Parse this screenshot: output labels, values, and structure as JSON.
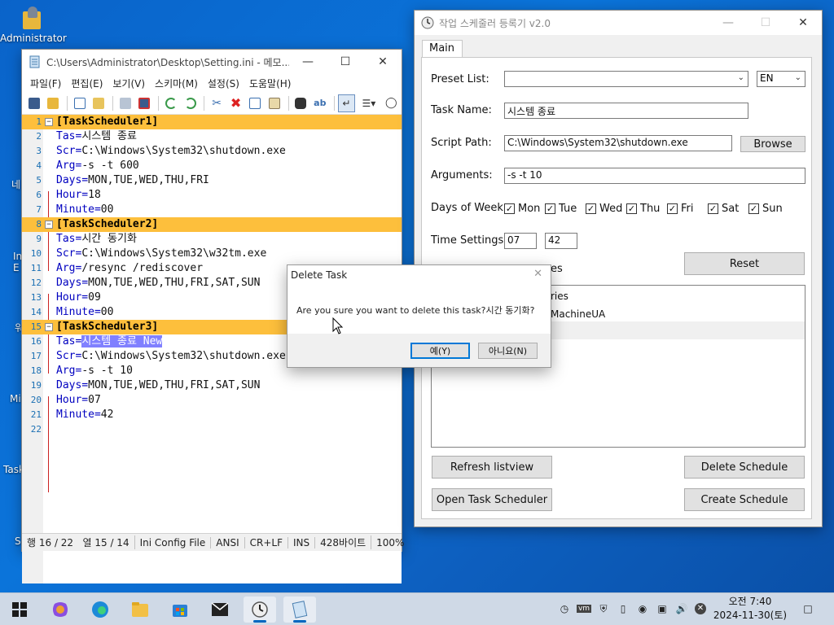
{
  "desktop": {
    "icon_label": "Administrator",
    "fragments": [
      "네",
      "In",
      "E",
      "워",
      "Mi",
      "Task",
      "S"
    ]
  },
  "notepad": {
    "title": "C:\\Users\\Administrator\\Desktop\\Setting.ini - 메모...",
    "menu": [
      "파일(F)",
      "편집(E)",
      "보기(V)",
      "스키마(M)",
      "설정(S)",
      "도움말(H)"
    ],
    "lines": [
      {
        "n": "1",
        "text": "[TaskScheduler1]",
        "section": true
      },
      {
        "n": "2",
        "key": "Tas=",
        "val": "시스템 종료"
      },
      {
        "n": "3",
        "key": "Scr=",
        "val": "C:\\Windows\\System32\\shutdown.exe"
      },
      {
        "n": "4",
        "key": "Arg=",
        "val": "-s -t 600"
      },
      {
        "n": "5",
        "key": "Days=",
        "val": "MON,TUE,WED,THU,FRI"
      },
      {
        "n": "6",
        "key": "Hour=",
        "val": "18"
      },
      {
        "n": "7",
        "key": "Minute=",
        "val": "00"
      },
      {
        "n": "8",
        "text": "[TaskScheduler2]",
        "section": true
      },
      {
        "n": "9",
        "key": "Tas=",
        "val": "시간 동기화"
      },
      {
        "n": "10",
        "key": "Scr=",
        "val": "C:\\Windows\\System32\\w32tm.exe"
      },
      {
        "n": "11",
        "key": "Arg=",
        "val": "/resync /rediscover"
      },
      {
        "n": "12",
        "key": "Days=",
        "val": "MON,TUE,WED,THU,FRI,SAT,SUN"
      },
      {
        "n": "13",
        "key": "Hour=",
        "val": "09"
      },
      {
        "n": "14",
        "key": "Minute=",
        "val": "00"
      },
      {
        "n": "15",
        "text": "[TaskScheduler3]",
        "section": true
      },
      {
        "n": "16",
        "key": "Tas=",
        "val": "시스템 종료 New",
        "selected": true
      },
      {
        "n": "17",
        "key": "Scr=",
        "val": "C:\\Windows\\System32\\shutdown.exe"
      },
      {
        "n": "18",
        "key": "Arg=",
        "val": "-s -t 10"
      },
      {
        "n": "19",
        "key": "Days=",
        "val": "MON,TUE,WED,THU,FRI,SAT,SUN"
      },
      {
        "n": "20",
        "key": "Hour=",
        "val": "07"
      },
      {
        "n": "21",
        "key": "Minute=",
        "val": "42"
      },
      {
        "n": "22",
        "key": "",
        "val": ""
      }
    ],
    "status": {
      "position": "행 16 / 22   열 15 / 14",
      "filetype": "Ini Config File",
      "encoding": "ANSI",
      "eol": "CR+LF",
      "mode": "INS",
      "size": "428바이트",
      "zoom": "100%"
    }
  },
  "scheduler": {
    "title": "작업 스케줄러 등록기 v2.0",
    "tab": "Main",
    "preset_label": "Preset List:",
    "preset_value": "",
    "lang_value": "EN",
    "task_name_label": "Task Name:",
    "task_name_value": "시스템 종료",
    "script_path_label": "Script Path:",
    "script_path_value": "C:\\Windows\\System32\\shutdown.exe",
    "browse_label": "Browse",
    "arguments_label": "Arguments:",
    "arguments_value": "-s -t 10",
    "days_label": "Days of Week:",
    "days": [
      {
        "label": "Mon",
        "checked": true
      },
      {
        "label": "Tue",
        "checked": true
      },
      {
        "label": "Wed",
        "checked": true
      },
      {
        "label": "Thu",
        "checked": true
      },
      {
        "label": "Fri",
        "checked": true
      },
      {
        "label": "Sat",
        "checked": true
      },
      {
        "label": "Sun",
        "checked": true
      }
    ],
    "time_label": "Time Settings:",
    "hour_value": "07",
    "minute_value": "42",
    "partial_label": "es",
    "reset_label": "Reset",
    "list_items": [
      "ries",
      "MachineUA",
      ""
    ],
    "refresh_label": "Refresh listview",
    "delete_label": "Delete Schedule",
    "open_label": "Open Task Scheduler",
    "create_label": "Create Schedule"
  },
  "dialog": {
    "title": "Delete Task",
    "message": "Are you sure you want to delete this task?시간 동기화?",
    "yes_label": "예(Y)",
    "no_label": "아니요(N)"
  },
  "taskbar": {
    "time": "오전 7:40",
    "date": "2024-11-30(토)"
  },
  "colors": {
    "section_bg": "#fdbf3c",
    "selection_bg": "#8080ff",
    "key_color": "#0000c0",
    "accent": "#0067c0"
  }
}
